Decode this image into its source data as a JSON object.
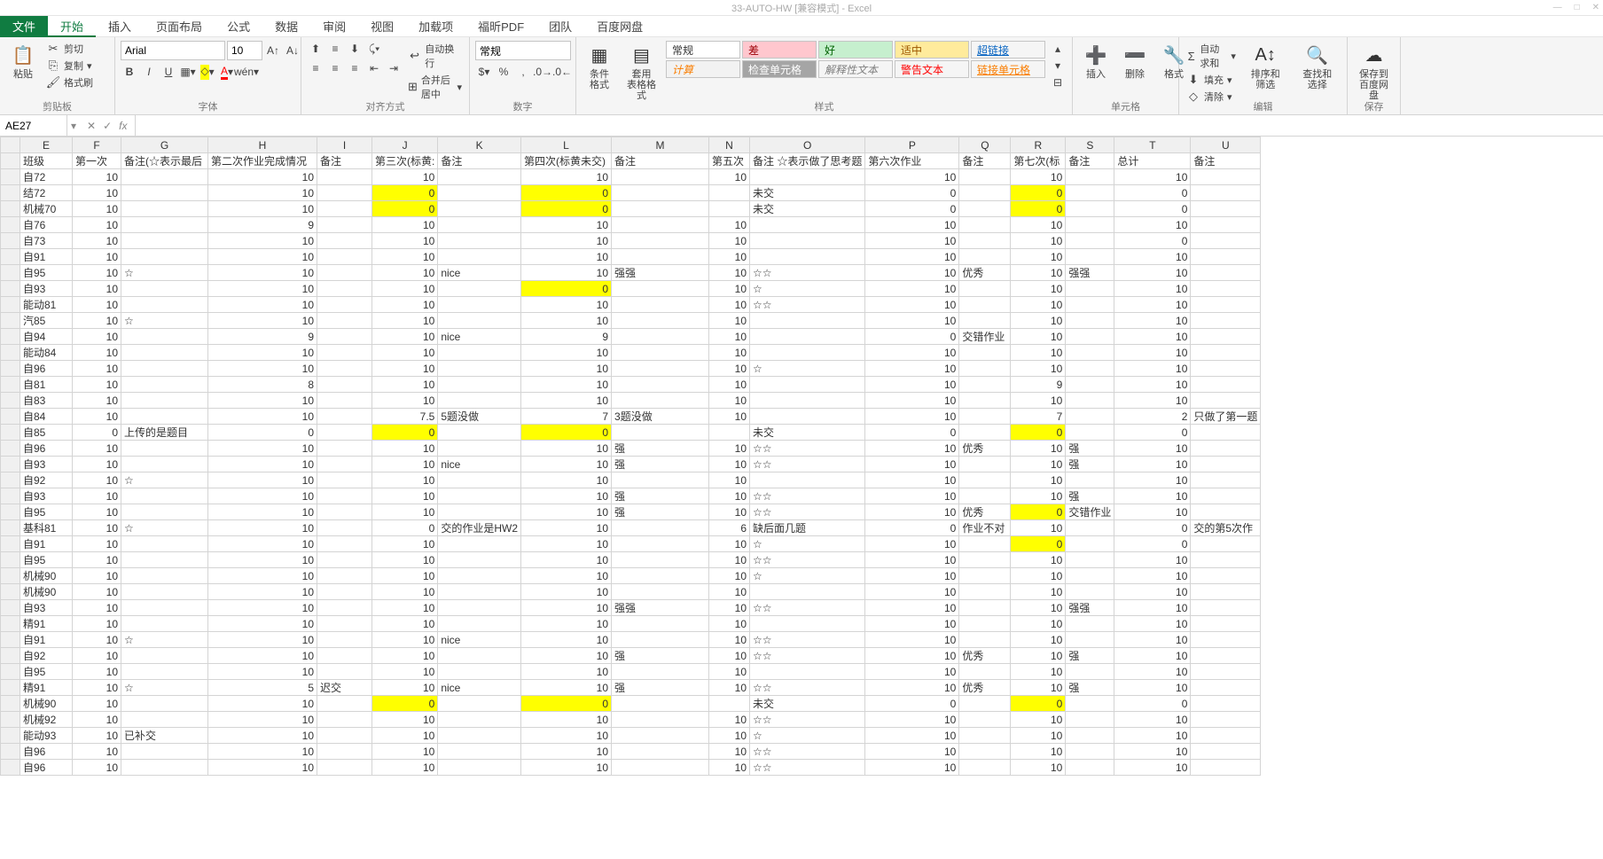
{
  "app": {
    "title": "33-AUTO-HW [兼容模式] - Excel"
  },
  "menu": {
    "file": "文件",
    "tabs": [
      "开始",
      "插入",
      "页面布局",
      "公式",
      "数据",
      "审阅",
      "视图",
      "加载项",
      "福昕PDF",
      "团队",
      "百度网盘"
    ]
  },
  "ribbon": {
    "clipboard": {
      "label": "剪贴板",
      "paste": "粘贴",
      "cut": "剪切",
      "copy": "复制",
      "painter": "格式刷"
    },
    "font": {
      "label": "字体",
      "name": "Arial",
      "size": "10"
    },
    "align": {
      "label": "对齐方式",
      "wrap": "自动换行",
      "merge": "合并后居中"
    },
    "number": {
      "label": "数字",
      "fmt": "常规"
    },
    "styles": {
      "label": "样式",
      "cond": "条件格式",
      "table": "套用\n表格格式",
      "s_normal": "常规",
      "s_bad": "差",
      "s_good": "好",
      "s_neutral": "适中",
      "s_calc": "计算",
      "s_check": "检查单元格",
      "s_explain": "解释性文本",
      "s_warn": "警告文本",
      "s_link": "超链接",
      "s_linkcell": "链接单元格"
    },
    "cells": {
      "label": "单元格",
      "insert": "插入",
      "delete": "删除",
      "format": "格式"
    },
    "edit": {
      "label": "编辑",
      "sum": "自动求和",
      "fill": "填充",
      "clear": "清除",
      "sort": "排序和筛选",
      "find": "查找和选择"
    },
    "save": {
      "label": "保存",
      "btn": "保存到\n百度网盘"
    }
  },
  "formula": {
    "cell": "AE27",
    "fx": "fx"
  },
  "cols": [
    "E",
    "F",
    "G",
    "H",
    "I",
    "J",
    "K",
    "L",
    "M",
    "N",
    "O",
    "P",
    "Q",
    "R",
    "S",
    "T",
    "U"
  ],
  "hdr": {
    "E": "班级",
    "F": "第一次",
    "G": "备注(☆表示最后",
    "H": "第二次作业完成情况",
    "I": "备注",
    "J": "第三次(标黄:",
    "K": "备注",
    "L": "第四次(标黄未交)",
    "M": "备注",
    "N": "第五次",
    "O": "备注 ☆表示做了思考题",
    "P": "第六次作业",
    "Q": "备注",
    "R": "第七次(标",
    "S": "备注",
    "T": "总计",
    "U": "备注"
  },
  "rows": [
    {
      "E": "自72",
      "F": "10",
      "H": "10",
      "J": "10",
      "L": "10",
      "N": "10",
      "P": "10",
      "R": "10",
      "T": "10"
    },
    {
      "E": "结72",
      "F": "10",
      "H": "10",
      "J": "0",
      "Jh": 1,
      "L": "0",
      "Lh": 1,
      "O": "未交",
      "P": "0",
      "R": "0",
      "Rh": 1,
      "T": "0"
    },
    {
      "E": "机械70",
      "F": "10",
      "H": "10",
      "J": "0",
      "Jh": 1,
      "L": "0",
      "Lh": 1,
      "O": "未交",
      "P": "0",
      "R": "0",
      "Rh": 1,
      "T": "0"
    },
    {
      "E": "自76",
      "F": "10",
      "H": "9",
      "J": "10",
      "L": "10",
      "N": "10",
      "P": "10",
      "R": "10",
      "T": "10"
    },
    {
      "E": "自73",
      "F": "10",
      "H": "10",
      "J": "10",
      "L": "10",
      "N": "10",
      "P": "10",
      "R": "10",
      "T": "0"
    },
    {
      "E": "自91",
      "F": "10",
      "H": "10",
      "J": "10",
      "L": "10",
      "N": "10",
      "P": "10",
      "R": "10",
      "T": "10"
    },
    {
      "E": "自95",
      "F": "10",
      "G": "☆",
      "H": "10",
      "J": "10",
      "K": "nice",
      "L": "10",
      "M": "强强",
      "N": "10",
      "O": "☆☆",
      "P": "10",
      "Q": "优秀",
      "R": "10",
      "S": "强强",
      "T": "10"
    },
    {
      "E": "自93",
      "F": "10",
      "H": "10",
      "J": "10",
      "L": "0",
      "Lh": 1,
      "N": "10",
      "O": "☆",
      "P": "10",
      "R": "10",
      "T": "10"
    },
    {
      "E": "能动81",
      "F": "10",
      "H": "10",
      "J": "10",
      "L": "10",
      "N": "10",
      "O": "☆☆",
      "P": "10",
      "R": "10",
      "T": "10"
    },
    {
      "E": "汽85",
      "F": "10",
      "G": "☆",
      "H": "10",
      "J": "10",
      "L": "10",
      "N": "10",
      "P": "10",
      "R": "10",
      "T": "10"
    },
    {
      "E": "自94",
      "F": "10",
      "H": "9",
      "J": "10",
      "K": "nice",
      "L": "9",
      "N": "10",
      "P": "0",
      "Q": "交错作业",
      "R": "10",
      "T": "10"
    },
    {
      "E": "能动84",
      "F": "10",
      "H": "10",
      "J": "10",
      "L": "10",
      "N": "10",
      "P": "10",
      "R": "10",
      "T": "10"
    },
    {
      "E": "自96",
      "F": "10",
      "H": "10",
      "J": "10",
      "L": "10",
      "N": "10",
      "O": "☆",
      "P": "10",
      "R": "10",
      "T": "10"
    },
    {
      "E": "自81",
      "F": "10",
      "H": "8",
      "J": "10",
      "L": "10",
      "N": "10",
      "P": "10",
      "R": "9",
      "T": "10"
    },
    {
      "E": "自83",
      "F": "10",
      "H": "10",
      "J": "10",
      "L": "10",
      "N": "10",
      "P": "10",
      "R": "10",
      "T": "10"
    },
    {
      "E": "自84",
      "F": "10",
      "H": "10",
      "J": "7.5",
      "K": "5题没做",
      "L": "7",
      "M": "3题没做",
      "N": "10",
      "P": "10",
      "R": "7",
      "T": "2",
      "U": "只做了第一题"
    },
    {
      "E": "自85",
      "F": "0",
      "G": "上传的是题目",
      "H": "0",
      "J": "0",
      "Jh": 1,
      "L": "0",
      "Lh": 1,
      "O": "未交",
      "P": "0",
      "R": "0",
      "Rh": 1,
      "T": "0"
    },
    {
      "E": "自96",
      "F": "10",
      "H": "10",
      "J": "10",
      "L": "10",
      "M": "强",
      "N": "10",
      "O": "☆☆",
      "P": "10",
      "Q": "优秀",
      "R": "10",
      "S": "强",
      "T": "10"
    },
    {
      "E": "自93",
      "F": "10",
      "H": "10",
      "J": "10",
      "K": "nice",
      "L": "10",
      "M": "强",
      "N": "10",
      "O": "☆☆",
      "P": "10",
      "R": "10",
      "S": "强",
      "T": "10"
    },
    {
      "E": "自92",
      "F": "10",
      "G": "☆",
      "H": "10",
      "J": "10",
      "L": "10",
      "N": "10",
      "P": "10",
      "R": "10",
      "T": "10"
    },
    {
      "E": "自93",
      "F": "10",
      "H": "10",
      "J": "10",
      "L": "10",
      "M": "强",
      "N": "10",
      "O": "☆☆",
      "P": "10",
      "R": "10",
      "S": "强",
      "T": "10"
    },
    {
      "E": "自95",
      "F": "10",
      "H": "10",
      "J": "10",
      "L": "10",
      "M": "强",
      "N": "10",
      "O": "☆☆",
      "P": "10",
      "Q": "优秀",
      "R": "0",
      "Rh": 1,
      "S": "交错作业",
      "T": "10"
    },
    {
      "E": "基科81",
      "F": "10",
      "G": "☆",
      "H": "10",
      "J": "0",
      "K": "交的作业是HW2",
      "L": "10",
      "N": "6",
      "O": "缺后面几题",
      "P": "0",
      "Q": "作业不对",
      "R": "10",
      "T": "0",
      "U": "交的第5次作"
    },
    {
      "E": "自91",
      "F": "10",
      "H": "10",
      "J": "10",
      "L": "10",
      "N": "10",
      "O": "☆",
      "P": "10",
      "R": "0",
      "Rh": 1,
      "T": "0"
    },
    {
      "E": "自95",
      "F": "10",
      "H": "10",
      "J": "10",
      "L": "10",
      "N": "10",
      "O": "☆☆",
      "P": "10",
      "R": "10",
      "T": "10"
    },
    {
      "E": "机械90",
      "F": "10",
      "H": "10",
      "J": "10",
      "L": "10",
      "N": "10",
      "O": "☆",
      "P": "10",
      "R": "10",
      "T": "10"
    },
    {
      "E": "机械90",
      "F": "10",
      "H": "10",
      "J": "10",
      "L": "10",
      "N": "10",
      "P": "10",
      "R": "10",
      "T": "10"
    },
    {
      "E": "自93",
      "F": "10",
      "H": "10",
      "J": "10",
      "L": "10",
      "M": "强强",
      "N": "10",
      "O": "☆☆",
      "P": "10",
      "R": "10",
      "S": "强强",
      "T": "10"
    },
    {
      "E": "精91",
      "F": "10",
      "H": "10",
      "J": "10",
      "L": "10",
      "N": "10",
      "P": "10",
      "R": "10",
      "T": "10"
    },
    {
      "E": "自91",
      "F": "10",
      "G": "☆",
      "H": "10",
      "J": "10",
      "K": "nice",
      "L": "10",
      "N": "10",
      "O": "☆☆",
      "P": "10",
      "R": "10",
      "T": "10"
    },
    {
      "E": "自92",
      "F": "10",
      "H": "10",
      "J": "10",
      "L": "10",
      "M": "强",
      "N": "10",
      "O": "☆☆",
      "P": "10",
      "Q": "优秀",
      "R": "10",
      "S": "强",
      "T": "10"
    },
    {
      "E": "自95",
      "F": "10",
      "H": "10",
      "J": "10",
      "L": "10",
      "N": "10",
      "P": "10",
      "R": "10",
      "T": "10"
    },
    {
      "E": "精91",
      "F": "10",
      "G": "☆",
      "H": "5",
      "I": "迟交",
      "J": "10",
      "K": "nice",
      "L": "10",
      "M": "强",
      "N": "10",
      "O": "☆☆",
      "P": "10",
      "Q": "优秀",
      "R": "10",
      "S": "强",
      "T": "10"
    },
    {
      "E": "机械90",
      "F": "10",
      "H": "10",
      "J": "0",
      "Jh": 1,
      "L": "0",
      "Lh": 1,
      "O": "未交",
      "P": "0",
      "R": "0",
      "Rh": 1,
      "T": "0"
    },
    {
      "E": "机械92",
      "F": "10",
      "H": "10",
      "J": "10",
      "L": "10",
      "N": "10",
      "O": "☆☆",
      "P": "10",
      "R": "10",
      "T": "10"
    },
    {
      "E": "能动93",
      "F": "10",
      "G": "已补交",
      "H": "10",
      "J": "10",
      "L": "10",
      "N": "10",
      "O": "☆",
      "P": "10",
      "R": "10",
      "T": "10"
    },
    {
      "E": "自96",
      "F": "10",
      "H": "10",
      "J": "10",
      "L": "10",
      "N": "10",
      "O": "☆☆",
      "P": "10",
      "R": "10",
      "T": "10"
    },
    {
      "E": "自96",
      "F": "10",
      "H": "10",
      "J": "10",
      "L": "10",
      "N": "10",
      "O": "☆☆",
      "P": "10",
      "R": "10",
      "T": "10"
    }
  ]
}
